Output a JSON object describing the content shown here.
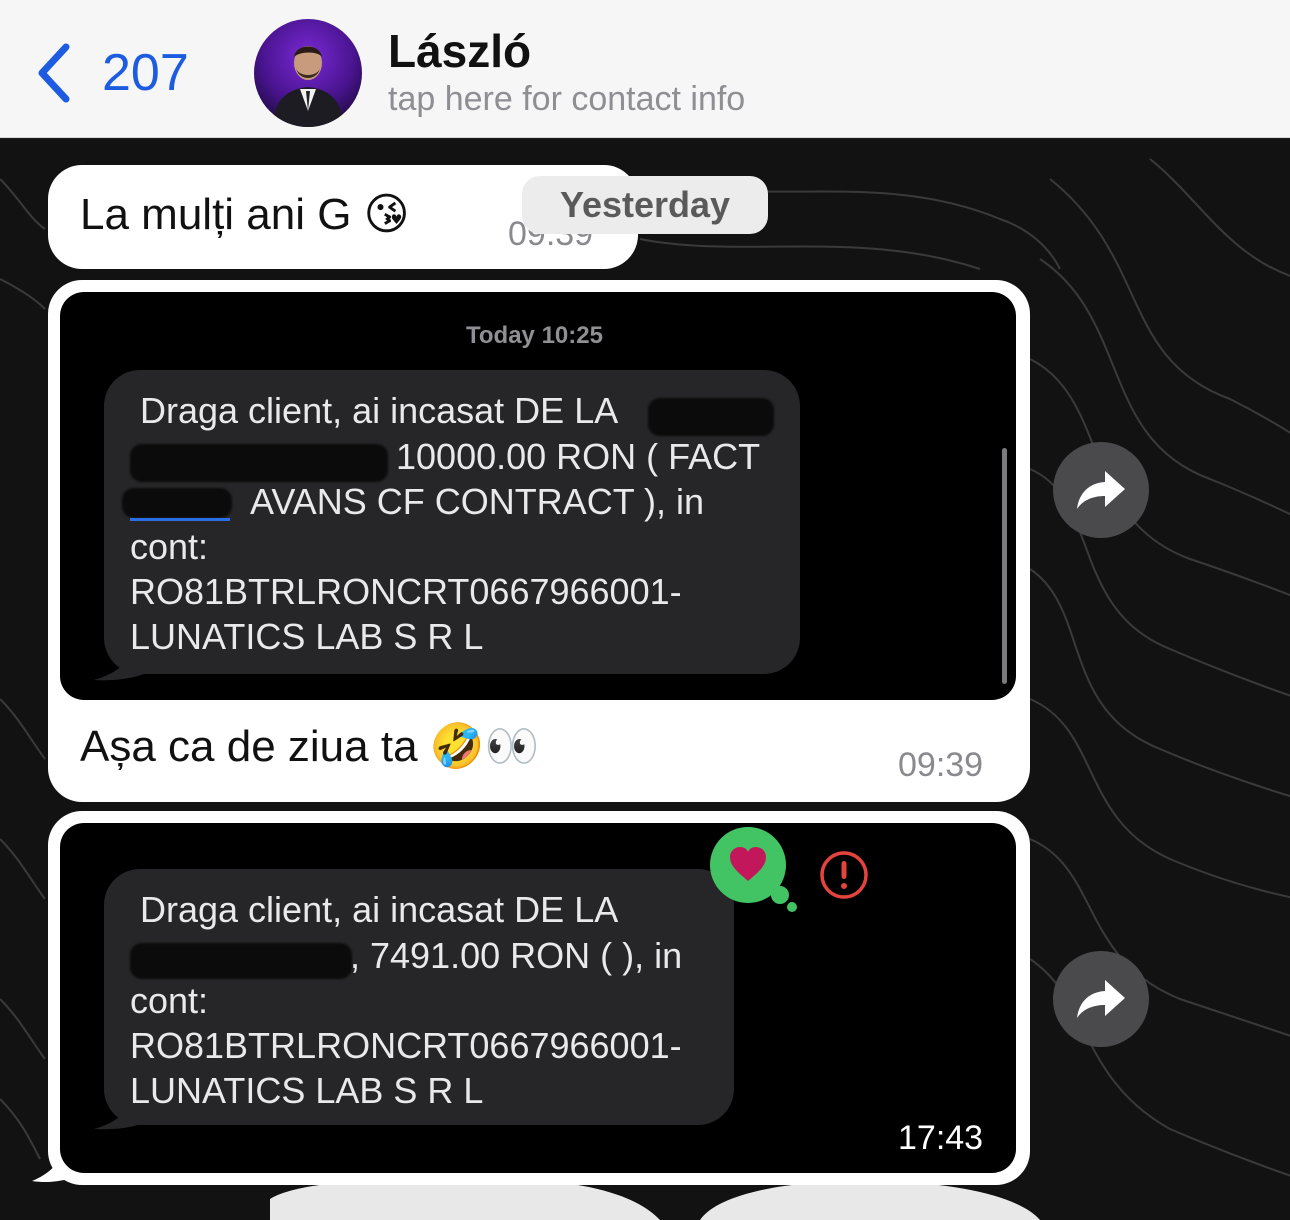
{
  "header": {
    "back_count": "207",
    "contact_name": "László",
    "contact_subtitle": "tap here for contact info"
  },
  "messages": {
    "first": {
      "text": "La mulți ani G 😘",
      "time": "09:39"
    },
    "date_separator": "Yesterday",
    "second": {
      "caption": "Așa ca de ziua ta 🤣👀",
      "time": "09:39"
    },
    "third": {
      "time": "17:43"
    }
  },
  "sms_one": {
    "stamp": "Today 10:25",
    "lines": [
      "Draga client, ai incasat DE LA",
      "10000.00 RON ( FACT",
      "AVANS CF CONTRACT ), in",
      "cont:",
      "RO81BTRLRONCRT0667966001-",
      "LUNATICS LAB S R L"
    ]
  },
  "sms_two": {
    "lines": [
      "Draga client, ai incasat DE LA",
      ", 7491.00 RON (  ), in",
      "cont:",
      "RO81BTRLRONCRT0667966001-",
      "LUNATICS LAB S R L"
    ]
  },
  "icons": {
    "back": "chevron-left-icon",
    "forward": "share-arrow-icon",
    "reaction": "heart-bubble-icon",
    "error": "exclamation-circle-icon"
  },
  "colors": {
    "accent": "#1d5ce0",
    "heart_bubble": "#43c464",
    "heart": "#c2185b",
    "error": "#e5433d"
  }
}
